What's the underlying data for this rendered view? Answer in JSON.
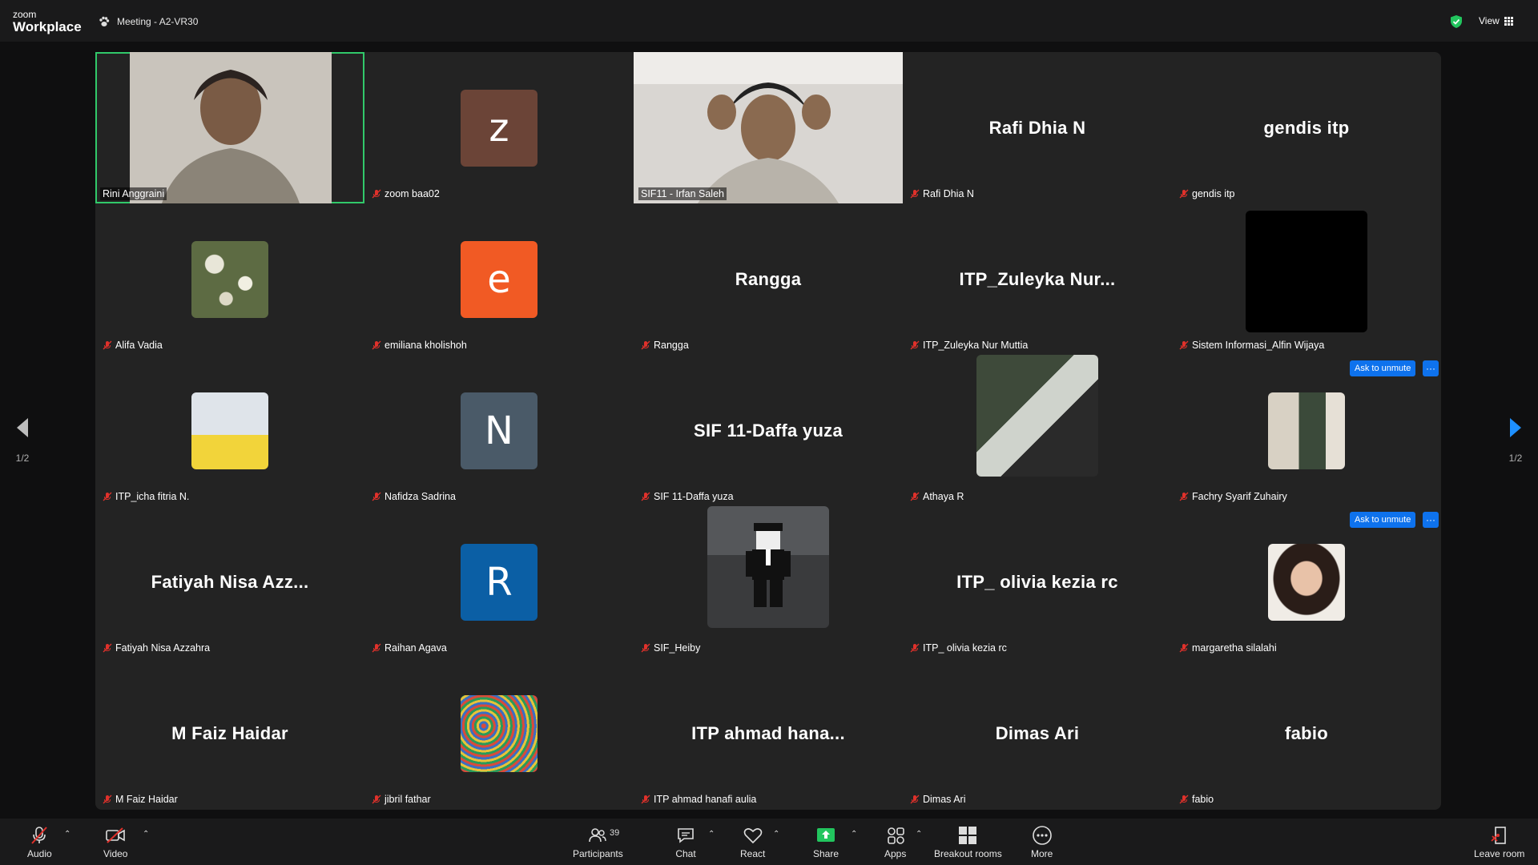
{
  "topbar": {
    "logo_top": "zoom",
    "logo_bottom": "Workplace",
    "meeting_title": "Meeting - A2-VR30",
    "view_label": "View"
  },
  "tiles": [
    {
      "name": "Rini Anggraini",
      "kind": "video",
      "display": "",
      "active": true,
      "muted": false
    },
    {
      "name": "zoom baa02",
      "kind": "avatar",
      "display": "z",
      "color": "#6b4437",
      "muted": true
    },
    {
      "name": "SIF11 - Irfan Saleh",
      "kind": "video",
      "display": "",
      "muted": false
    },
    {
      "name": "Rafi Dhia N",
      "kind": "text",
      "display": "Rafi Dhia N",
      "muted": true
    },
    {
      "name": "gendis itp",
      "kind": "text",
      "display": "gendis itp",
      "muted": true
    },
    {
      "name": "Alifa Vadia",
      "kind": "photo",
      "display": "",
      "muted": true
    },
    {
      "name": "emiliana kholishoh",
      "kind": "avatar",
      "display": "e",
      "color": "#f15a24",
      "muted": true
    },
    {
      "name": "Rangga",
      "kind": "text",
      "display": "Rangga",
      "muted": true
    },
    {
      "name": "ITP_Zuleyka Nur Muttia",
      "kind": "text",
      "display": "ITP_Zuleyka  Nur...",
      "muted": true
    },
    {
      "name": "Sistem Informasi_Alfin Wijaya",
      "kind": "black",
      "display": "",
      "muted": true
    },
    {
      "name": "ITP_icha fitria N.",
      "kind": "photo",
      "display": "",
      "muted": true
    },
    {
      "name": "Nafidza Sadrina",
      "kind": "avatar",
      "display": "N",
      "color": "#4a5a68",
      "muted": true
    },
    {
      "name": "SIF 11-Daffa yuza",
      "kind": "text",
      "display": "SIF 11-Daffa yuza",
      "muted": true
    },
    {
      "name": "Athaya R",
      "kind": "photo",
      "display": "",
      "muted": true
    },
    {
      "name": "Fachry Syarif Zuhairy",
      "kind": "photo",
      "display": "",
      "muted": true
    },
    {
      "name": "Fatiyah Nisa Azzahra",
      "kind": "text",
      "display": "Fatiyah  Nisa  Azz...",
      "muted": true
    },
    {
      "name": "Raihan Agava",
      "kind": "avatar",
      "display": "R",
      "color": "#0b5fa5",
      "muted": true
    },
    {
      "name": "SIF_Heiby",
      "kind": "photo",
      "display": "",
      "muted": true
    },
    {
      "name": "ITP_ olivia kezia rc",
      "kind": "text",
      "display": "ITP_ olivia kezia rc",
      "muted": true
    },
    {
      "name": "margaretha silalahi",
      "kind": "photo",
      "display": "",
      "muted": true
    },
    {
      "name": "M Faiz Haidar",
      "kind": "text",
      "display": "M Faiz Haidar",
      "muted": true
    },
    {
      "name": "jibril fathar",
      "kind": "photo",
      "display": "",
      "muted": true
    },
    {
      "name": "ITP ahmad hanafi aulia",
      "kind": "text",
      "display": "ITP  ahmad  hana...",
      "muted": true
    },
    {
      "name": "Dimas Ari",
      "kind": "text",
      "display": "Dimas Ari",
      "muted": true
    },
    {
      "name": "fabio",
      "kind": "text",
      "display": "fabio",
      "muted": true
    }
  ],
  "ask_to_unmute": "Ask to unmute",
  "pager": {
    "current": "1/2"
  },
  "toolbar": {
    "audio": "Audio",
    "video": "Video",
    "participants": "Participants",
    "participants_count": "39",
    "chat": "Chat",
    "react": "React",
    "share": "Share",
    "apps": "Apps",
    "breakout": "Breakout rooms",
    "more": "More",
    "leave": "Leave room"
  },
  "colors": {
    "accent": "#0e72ed",
    "active_border": "#31c96a",
    "share_green": "#22c55e",
    "muted_red": "#e0312b"
  }
}
